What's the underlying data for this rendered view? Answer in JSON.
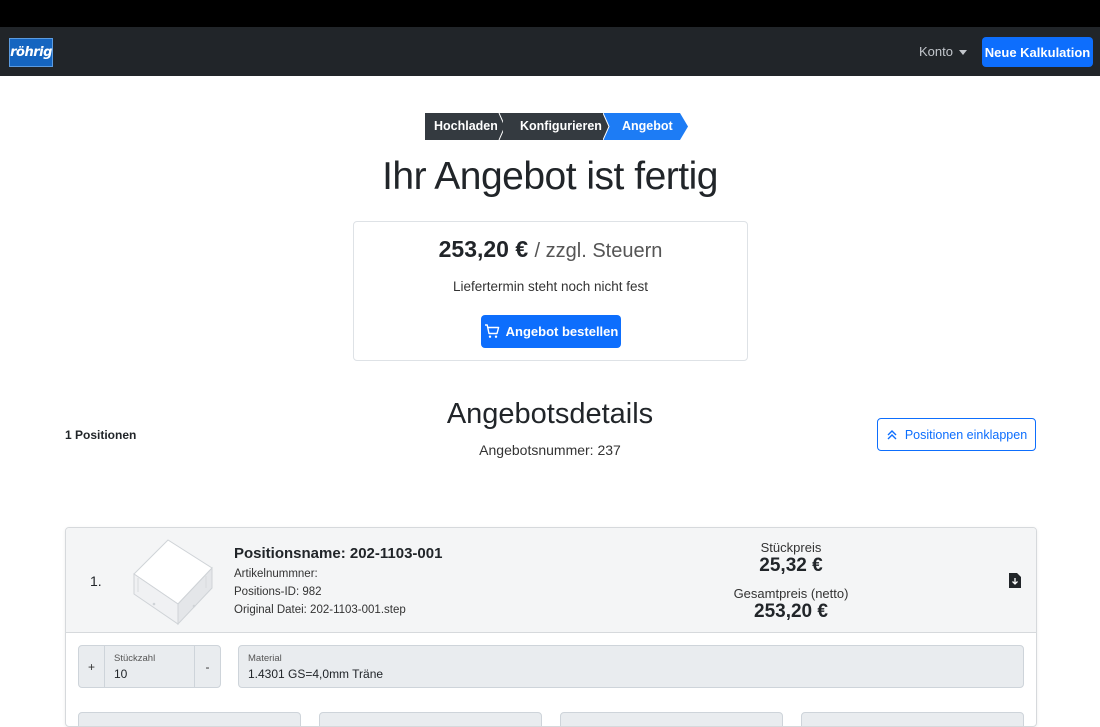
{
  "navbar": {
    "logo_text": "röhrig",
    "konto_label": "Konto",
    "new_calc_label": "Neue Kalkulation"
  },
  "stepper": {
    "steps": [
      "Hochladen",
      "Konfigurieren",
      "Angebot"
    ],
    "active": "Angebot"
  },
  "hero": {
    "title": "Ihr Angebot ist fertig"
  },
  "summary": {
    "price": "253,20 €",
    "tax_note": "/ zzgl. Steuern",
    "delivery": "Liefertermin steht noch nicht fest",
    "order_label": "Angebot bestellen"
  },
  "details": {
    "positions_count": "1 Positionen",
    "title": "Angebotsdetails",
    "offer_number": "Angebotsnummer: 237",
    "collapse_label": "Positionen einklappen"
  },
  "position": {
    "index": "1.",
    "name": "Positionsname: 202-1103-001",
    "article_no": "Artikelnummner:",
    "position_id": "Positions-ID: 982",
    "original_file": "Original Datei: 202-1103-001.step",
    "unit_price_label": "Stückpreis",
    "unit_price": "25,32 €",
    "total_label": "Gesamtpreis (netto)",
    "total_price": "253,20 €",
    "qty_plus": "+",
    "qty_minus": "-",
    "qty_label": "Stückzahl",
    "qty_value": "10",
    "material_label": "Material",
    "material_value": "1.4301 GS=4,0mm Träne"
  },
  "colors": {
    "navbar_bg": "#212529",
    "primary": "#0d6efd",
    "step_dark": "#343a40",
    "step_active": "#1d7cf5"
  }
}
